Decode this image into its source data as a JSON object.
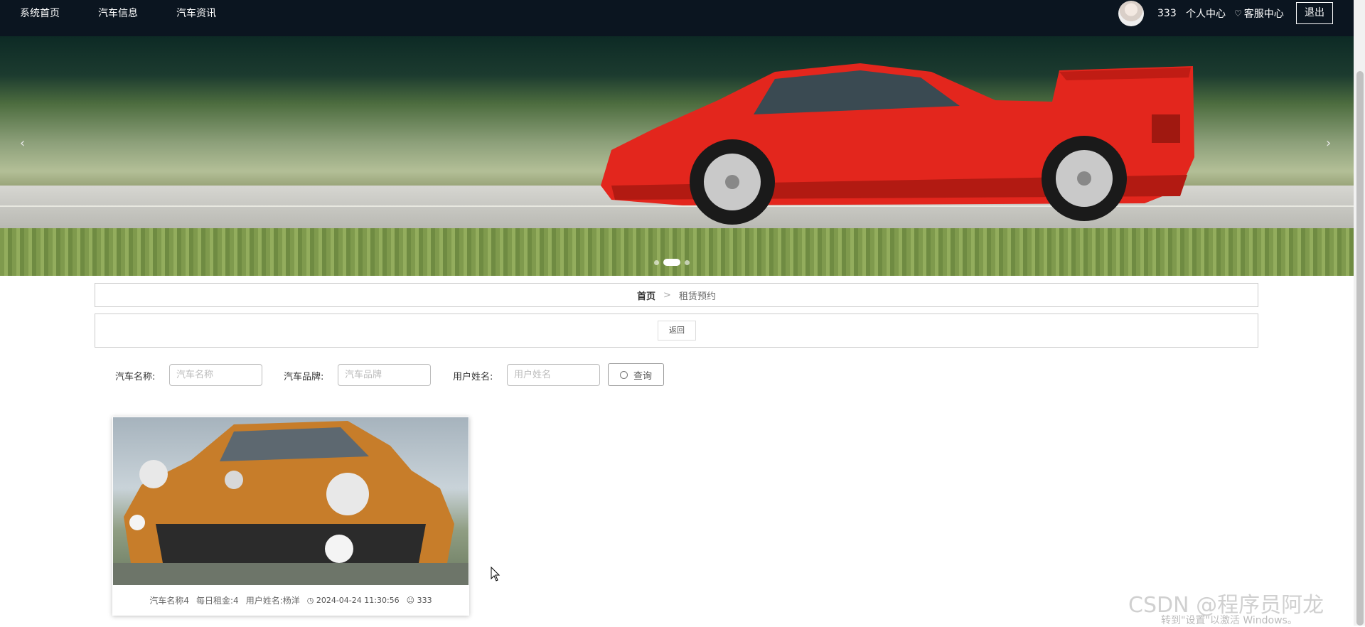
{
  "nav": {
    "items": [
      "系统首页",
      "汽车信息",
      "汽车资讯"
    ],
    "username": "333",
    "profile": "个人中心",
    "service": "客服中心",
    "logout": "退出"
  },
  "banner": {
    "prev": "‹",
    "next": "›",
    "dots": 3,
    "active_dot": 1
  },
  "breadcrumb": {
    "home": "首页",
    "separator": ">",
    "current": "租赁预约"
  },
  "back_label": "返回",
  "search": {
    "car_name_label": "汽车名称:",
    "car_name_placeholder": "汽车名称",
    "brand_label": "汽车品牌:",
    "brand_placeholder": "汽车品牌",
    "user_label": "用户姓名:",
    "user_placeholder": "用户姓名",
    "query_label": "查询"
  },
  "cards": [
    {
      "name": "汽车名称4",
      "rent": "每日租金:4",
      "user": "用户姓名:杨洋",
      "time": "2024-04-24 11:30:56",
      "account": "333"
    }
  ],
  "watermark": {
    "line1": "CSDN @程序员阿龙",
    "line2": "转到\"设置\"以激活 Windows。"
  }
}
